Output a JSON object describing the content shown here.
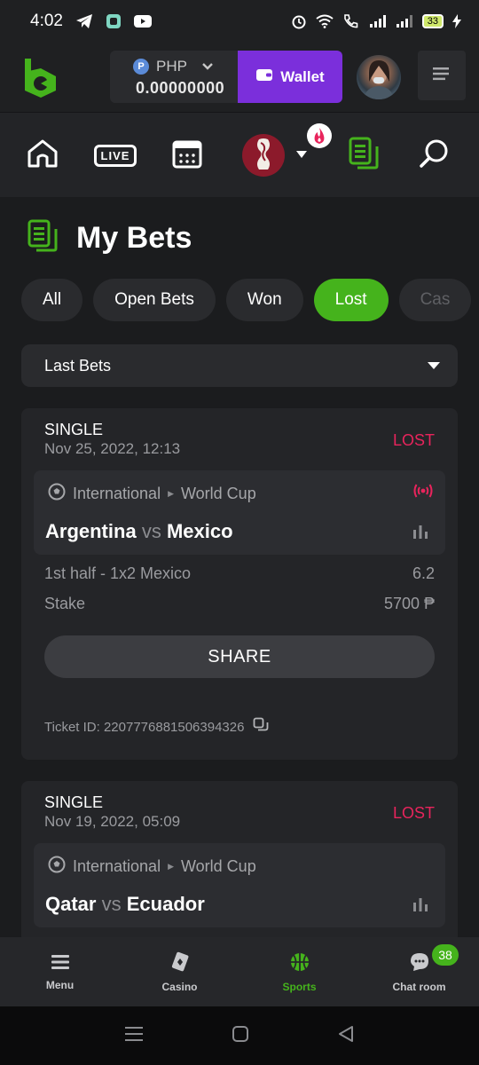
{
  "status_bar": {
    "time": "4:02",
    "battery": "33"
  },
  "header": {
    "currency": "PHP",
    "coin_symbol": "P",
    "balance": "0.00000000",
    "wallet_label": "Wallet"
  },
  "nav": {
    "live_label": "LIVE"
  },
  "page": {
    "title": "My Bets"
  },
  "filters": [
    {
      "label": "All",
      "active": false
    },
    {
      "label": "Open Bets",
      "active": false
    },
    {
      "label": "Won",
      "active": false
    },
    {
      "label": "Lost",
      "active": true
    },
    {
      "label": "Cas",
      "active": false
    }
  ],
  "dropdown": {
    "selected": "Last Bets"
  },
  "bets": [
    {
      "type": "SINGLE",
      "date": "Nov 25, 2022, 12:13",
      "status": "LOST",
      "league": "International",
      "tournament": "World Cup",
      "home": "Argentina",
      "vs": "vs",
      "away": "Mexico",
      "market": "1st half - 1x2 Mexico",
      "odds": "6.2",
      "stake_label": "Stake",
      "stake": "5700 ₱",
      "share_label": "SHARE",
      "ticket": "Ticket ID: 2207776881506394326"
    },
    {
      "type": "SINGLE",
      "date": "Nov 19, 2022, 05:09",
      "status": "LOST",
      "league": "International",
      "tournament": "World Cup",
      "home": "Qatar",
      "vs": "vs",
      "away": "Ecuador"
    }
  ],
  "bottom_tabs": [
    {
      "label": "Menu",
      "icon": "menu-icon"
    },
    {
      "label": "Casino",
      "icon": "casino-icon"
    },
    {
      "label": "Sports",
      "icon": "basketball-icon",
      "active": true
    },
    {
      "label": "Chat room",
      "icon": "chat-icon",
      "badge": "38"
    }
  ],
  "colors": {
    "accent_green": "#45b31c",
    "wallet_purple": "#7b2fdb",
    "lost_red": "#e8245c"
  }
}
